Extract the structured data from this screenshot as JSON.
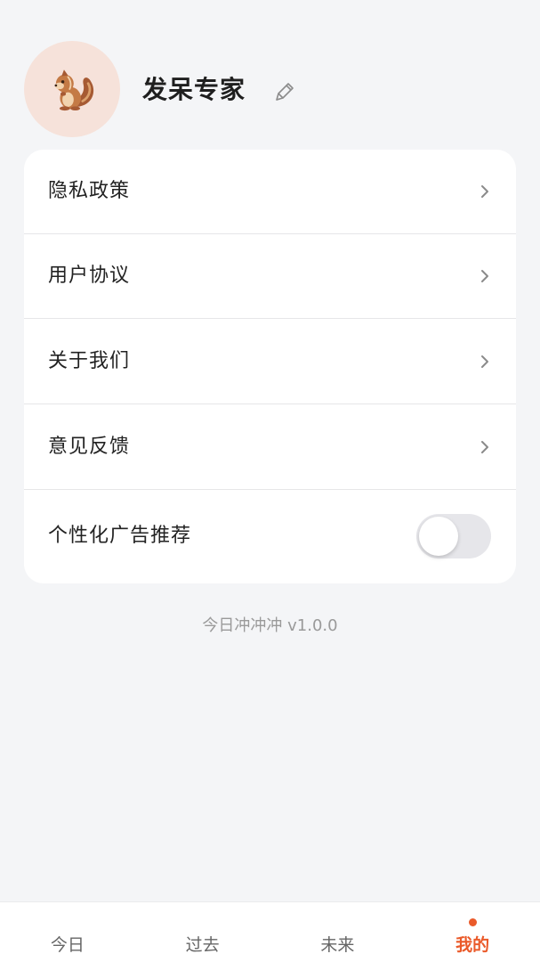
{
  "profile": {
    "name": "发呆专家",
    "avatar_icon": "squirrel-icon",
    "edit_icon": "pencil-icon"
  },
  "menu": [
    {
      "label": "隐私政策",
      "icon": "chevron-right-icon"
    },
    {
      "label": "用户协议",
      "icon": "chevron-right-icon"
    },
    {
      "label": "关于我们",
      "icon": "chevron-right-icon"
    },
    {
      "label": "意见反馈",
      "icon": "chevron-right-icon"
    }
  ],
  "ad_toggle": {
    "label": "个性化广告推荐",
    "enabled": false
  },
  "version_text": "今日冲冲冲 v1.0.0",
  "tabs": [
    {
      "label": "今日",
      "active": false,
      "badge_dot": false
    },
    {
      "label": "过去",
      "active": false,
      "badge_dot": false
    },
    {
      "label": "未来",
      "active": false,
      "badge_dot": false
    },
    {
      "label": "我的",
      "active": true,
      "badge_dot": true
    }
  ],
  "colors": {
    "accent": "#ea5a2a",
    "background": "#f4f5f7",
    "avatar_bg": "#f6e2da"
  }
}
